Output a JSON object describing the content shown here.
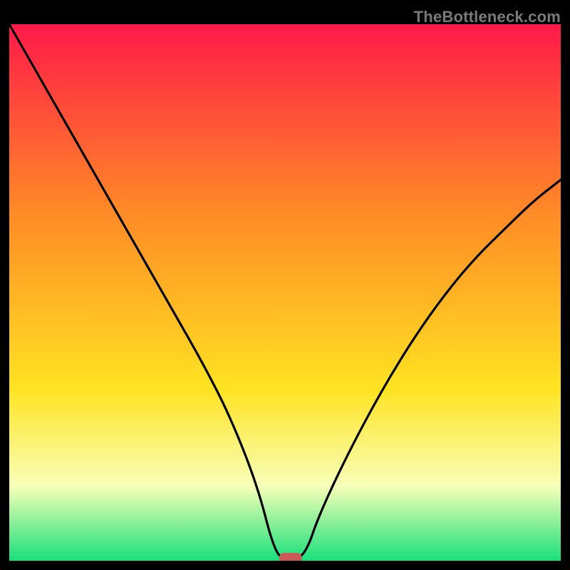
{
  "watermark": "TheBottleneck.com",
  "colors": {
    "gradient_top": "#ff1a49",
    "gradient_mid1": "#ff8a26",
    "gradient_mid2": "#ffe322",
    "gradient_band": "#f8ffb8",
    "gradient_bottom": "#18e07a",
    "curve": "#000000",
    "marker": "#cc5a57"
  },
  "chart_data": {
    "type": "line",
    "title": "",
    "xlabel": "",
    "ylabel": "",
    "ylim": [
      0,
      100
    ],
    "xlim": [
      0,
      100
    ],
    "series": [
      {
        "name": "bottleneck-curve",
        "x": [
          0,
          5,
          10,
          15,
          20,
          25,
          30,
          35,
          40,
          45,
          48,
          50,
          52,
          54,
          56,
          60,
          65,
          70,
          75,
          80,
          85,
          90,
          95,
          100
        ],
        "values": [
          100,
          91,
          82,
          73,
          64,
          55,
          46,
          37,
          27,
          14,
          2,
          0,
          0,
          2,
          8,
          17,
          27,
          36,
          44,
          51,
          57,
          62,
          67,
          71
        ]
      }
    ],
    "marker": {
      "x": 51,
      "y": 0
    },
    "gradient_stops": [
      {
        "pos": 0.0,
        "color": "#ff1a49"
      },
      {
        "pos": 0.35,
        "color": "#ff8a26"
      },
      {
        "pos": 0.68,
        "color": "#ffe322"
      },
      {
        "pos": 0.86,
        "color": "#f8ffb8"
      },
      {
        "pos": 1.0,
        "color": "#18e07a"
      }
    ]
  }
}
